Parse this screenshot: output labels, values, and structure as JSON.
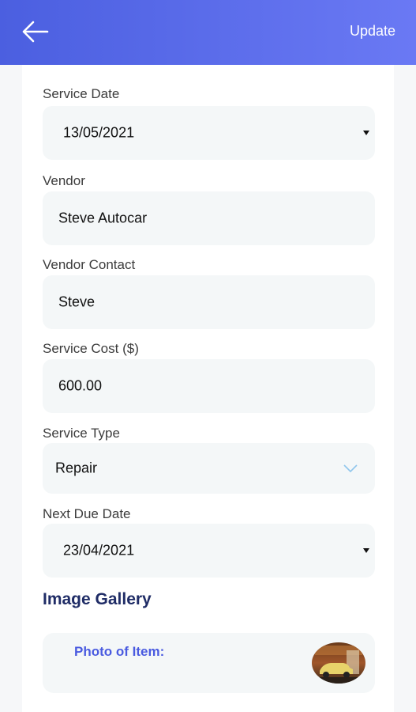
{
  "header": {
    "update_label": "Update"
  },
  "form": {
    "service_date": {
      "label": "Service Date",
      "value": "13/05/2021"
    },
    "vendor": {
      "label": "Vendor",
      "value": "Steve Autocar"
    },
    "vendor_contact": {
      "label": "Vendor Contact",
      "value": "Steve"
    },
    "service_cost": {
      "label": "Service Cost ($)",
      "value": "600.00"
    },
    "service_type": {
      "label": "Service Type",
      "value": "Repair"
    },
    "next_due_date": {
      "label": "Next Due Date",
      "value": "23/04/2021"
    }
  },
  "gallery": {
    "title": "Image Gallery",
    "photo_label": "Photo of Item:"
  },
  "icons": {
    "back": "arrow-left-icon",
    "dropdown_caret": "caret-down-icon",
    "chevron": "chevron-down-icon"
  },
  "colors": {
    "header_start": "#4b5fe0",
    "header_end": "#6a79f4",
    "field_bg": "#f4f7f8",
    "accent": "#4a5be0",
    "gallery_title": "#1f2c66"
  }
}
